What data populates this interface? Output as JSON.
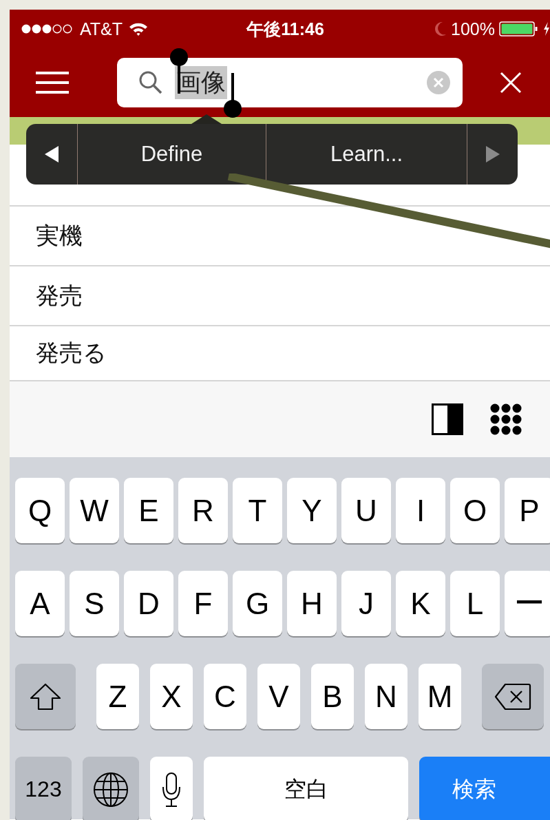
{
  "status_bar": {
    "carrier": "AT&T",
    "time": "午後11:46",
    "battery": "100%"
  },
  "search": {
    "value": "画像"
  },
  "popup": [
    {
      "kind": "arrow",
      "disabled": false
    },
    {
      "kind": "label",
      "text": "Define"
    },
    {
      "kind": "label",
      "text": "Learn..."
    },
    {
      "kind": "arrow",
      "disabled": true
    }
  ],
  "suggestions": [
    "実機",
    "発売",
    "発売る"
  ],
  "keyboard": {
    "rows": [
      {
        "keys": [
          {
            "kind": "letter",
            "label": "Q"
          },
          {
            "kind": "letter",
            "label": "W"
          },
          {
            "kind": "letter",
            "label": "E"
          },
          {
            "kind": "letter",
            "label": "R"
          },
          {
            "kind": "letter",
            "label": "T"
          },
          {
            "kind": "letter",
            "label": "Y"
          },
          {
            "kind": "letter",
            "label": "U"
          },
          {
            "kind": "letter",
            "label": "I"
          },
          {
            "kind": "letter",
            "label": "O"
          },
          {
            "kind": "letter",
            "label": "P"
          }
        ]
      },
      {
        "keys": [
          {
            "kind": "letter",
            "label": "A"
          },
          {
            "kind": "letter",
            "label": "S"
          },
          {
            "kind": "letter",
            "label": "D"
          },
          {
            "kind": "letter",
            "label": "F"
          },
          {
            "kind": "letter",
            "label": "G"
          },
          {
            "kind": "letter",
            "label": "H"
          },
          {
            "kind": "letter",
            "label": "J"
          },
          {
            "kind": "letter",
            "label": "K"
          },
          {
            "kind": "letter",
            "label": "L"
          },
          {
            "kind": "letter",
            "label": "ー"
          }
        ]
      },
      {
        "keys": [
          {
            "kind": "shift"
          },
          {
            "kind": "letter",
            "label": "Z"
          },
          {
            "kind": "letter",
            "label": "X"
          },
          {
            "kind": "letter",
            "label": "C"
          },
          {
            "kind": "letter",
            "label": "V"
          },
          {
            "kind": "letter",
            "label": "B"
          },
          {
            "kind": "letter",
            "label": "N"
          },
          {
            "kind": "letter",
            "label": "M"
          },
          {
            "kind": "delete"
          }
        ]
      },
      {
        "keys": [
          {
            "kind": "numbers",
            "label": "123"
          },
          {
            "kind": "globe"
          },
          {
            "kind": "mic"
          },
          {
            "kind": "space",
            "label": "空白"
          },
          {
            "kind": "search",
            "label": "検索"
          }
        ]
      }
    ]
  }
}
